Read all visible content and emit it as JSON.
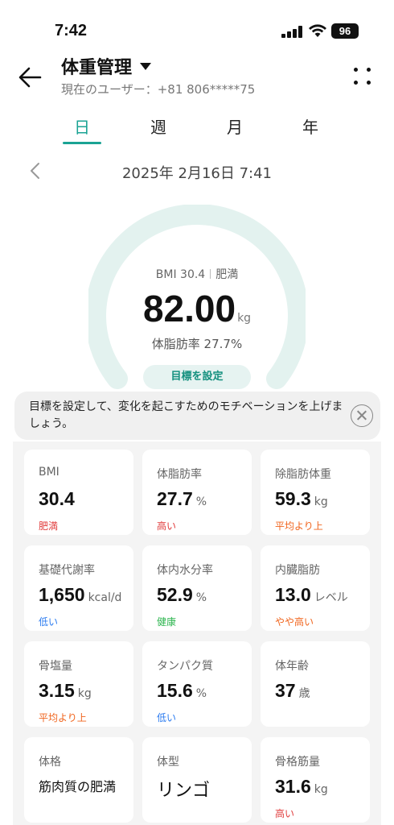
{
  "status_bar": {
    "time": "7:42",
    "battery": "96"
  },
  "header": {
    "title": "体重管理",
    "subtitle": "現在のユーザー：+81 806*****75"
  },
  "tabs": [
    {
      "label": "日",
      "active": true
    },
    {
      "label": "週",
      "active": false
    },
    {
      "label": "月",
      "active": false
    },
    {
      "label": "年",
      "active": false
    }
  ],
  "date": "2025年 2月16日 7:41",
  "gauge": {
    "bmi_text": "BMI 30.4",
    "bmi_category": "肥満",
    "weight": "82.00",
    "weight_unit": "kg",
    "body_fat_text": "体脂肪率 27.7%",
    "goal_button": "目標を設定"
  },
  "tip": {
    "text": "目標を設定して、変化を起こすためのモチベーションを上げましょう。"
  },
  "colors": {
    "accent": "#1aa394",
    "gauge_track": "#e3f2ef",
    "status_red": "#e03c3c",
    "status_orange": "#f0651e",
    "status_blue": "#2c7cf0",
    "status_green": "#2db54f"
  },
  "metrics": [
    {
      "label": "BMI",
      "value": "30.4",
      "unit": "",
      "status": "肥満",
      "status_color": "#e03c3c"
    },
    {
      "label": "体脂肪率",
      "value": "27.7",
      "unit": "%",
      "status": "高い",
      "status_color": "#e03c3c"
    },
    {
      "label": "除脂肪体重",
      "value": "59.3",
      "unit": "kg",
      "status": "平均より上",
      "status_color": "#f0651e"
    },
    {
      "label": "基礎代謝率",
      "value": "1,650",
      "unit": "kcal/d",
      "status": "低い",
      "status_color": "#2c7cf0"
    },
    {
      "label": "体内水分率",
      "value": "52.9",
      "unit": "%",
      "status": "健康",
      "status_color": "#2db54f"
    },
    {
      "label": "内臓脂肪",
      "value": "13.0",
      "unit": "レベル",
      "status": "やや高い",
      "status_color": "#f0651e"
    },
    {
      "label": "骨塩量",
      "value": "3.15",
      "unit": "kg",
      "status": "平均より上",
      "status_color": "#f0651e"
    },
    {
      "label": "タンパク質",
      "value": "15.6",
      "unit": "%",
      "status": "低い",
      "status_color": "#2c7cf0"
    },
    {
      "label": "体年齢",
      "value": "37",
      "unit": "歳",
      "status": "",
      "status_color": ""
    },
    {
      "label": "体格",
      "value": "筋肉質の肥満",
      "unit": "",
      "status": "",
      "status_color": ""
    },
    {
      "label": "体型",
      "value": "リンゴ",
      "unit": "",
      "status": "",
      "status_color": ""
    },
    {
      "label": "骨格筋量",
      "value": "31.6",
      "unit": "kg",
      "status": "高い",
      "status_color": "#e03c3c"
    }
  ]
}
